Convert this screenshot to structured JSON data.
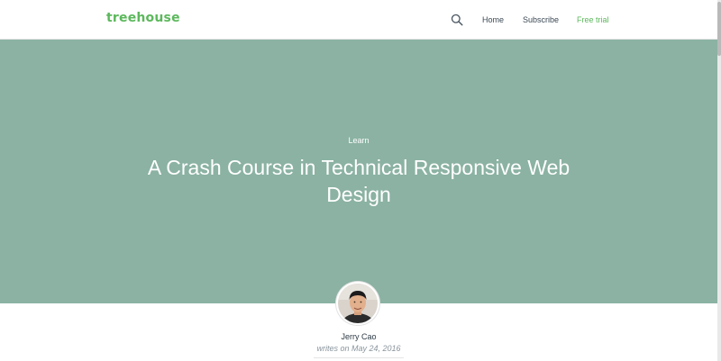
{
  "header": {
    "logo": "treehouse",
    "nav": {
      "home": "Home",
      "subscribe": "Subscribe",
      "free_trial": "Free trial"
    }
  },
  "icons": {
    "search": "search-icon"
  },
  "colors": {
    "brand_green": "#5cb85c",
    "hero_background": "#8bb2a3"
  },
  "hero": {
    "category": "Learn",
    "title": "A Crash Course in Technical Responsive Web Design"
  },
  "author": {
    "name": "Jerry Cao",
    "byline": "writes on May 24, 2016"
  }
}
